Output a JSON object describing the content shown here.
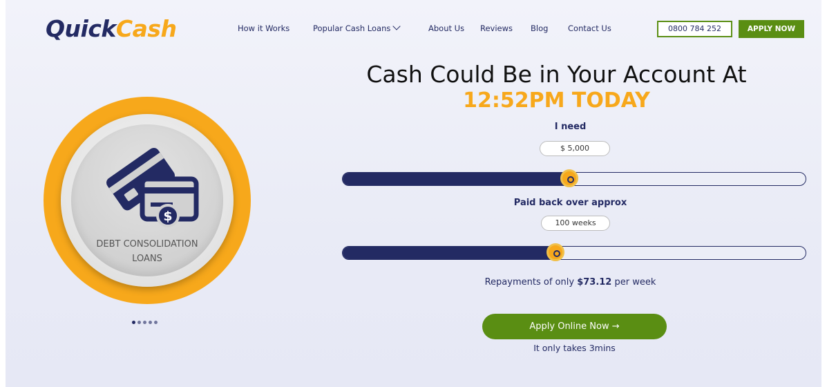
{
  "header": {
    "logo_part1": "Quick",
    "logo_part2": "Cash",
    "nav": [
      "How it Works",
      "Popular Cash Loans",
      "About Us",
      "Reviews",
      "Blog",
      "Contact Us"
    ],
    "phone": "0800 784 252",
    "apply_label": "APPLY NOW"
  },
  "carousel": {
    "label_line1": "DEBT CONSOLIDATION",
    "label_line2": "LOANS",
    "icon": "credit-cards-dollar-icon",
    "dot_count": 5,
    "active_dot": 0
  },
  "calculator": {
    "headline": "Cash Could Be in Your Account At",
    "time": "12:52PM TODAY",
    "amount_label": "I need",
    "amount_value": "$ 5,000",
    "amount_fraction": 0.49,
    "term_label": "Paid back over approx",
    "term_value": "100 weeks",
    "term_fraction": 0.46,
    "repay_prefix": "Repayments of only",
    "repay_amount": "$73.12",
    "repay_suffix": "per week",
    "cta": "Apply Online Now →",
    "note": "It only takes 3mins"
  },
  "colors": {
    "navy": "#232a63",
    "orange": "#f7a81b",
    "green": "#5a8e13"
  }
}
